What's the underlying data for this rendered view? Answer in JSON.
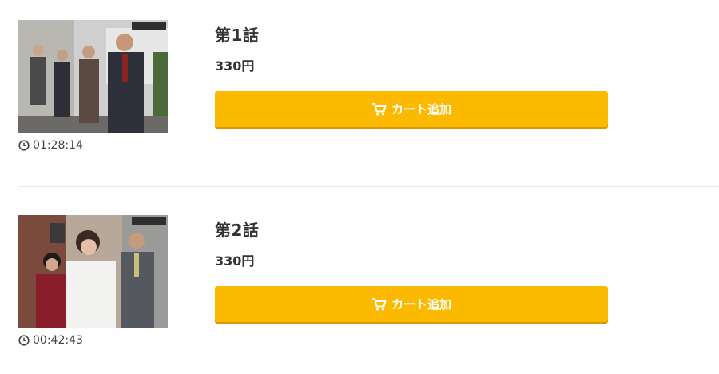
{
  "episodes": [
    {
      "title": "第1話",
      "price": "330円",
      "duration": "01:28:14",
      "button_label": "カート追加",
      "thumbnail_alt": "第1話"
    },
    {
      "title": "第2話",
      "price": "330円",
      "duration": "00:42:43",
      "button_label": "カート追加",
      "thumbnail_alt": "第2話"
    }
  ],
  "colors": {
    "button": "#fbb900",
    "button_text": "#ffffff",
    "text": "#333333",
    "divider": "#e8e8e8"
  },
  "icons": {
    "cart": "cart-icon",
    "clock": "clock-icon"
  }
}
